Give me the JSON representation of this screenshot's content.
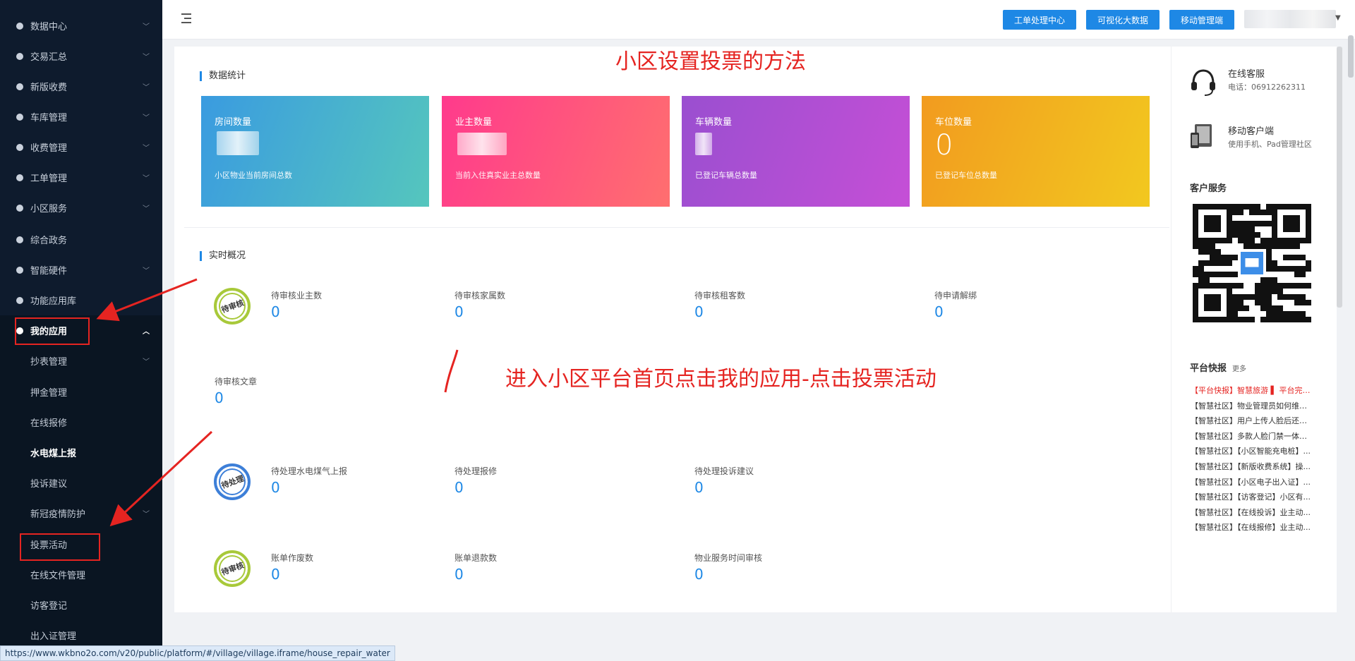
{
  "sidebar": {
    "items": [
      {
        "label": "数据中心",
        "icon": "database-icon"
      },
      {
        "label": "交易汇总",
        "icon": "money-bag-icon"
      },
      {
        "label": "新版收费",
        "icon": "payment-icon"
      },
      {
        "label": "车库管理",
        "icon": "car-icon"
      },
      {
        "label": "收费管理",
        "icon": "money-bag-icon"
      },
      {
        "label": "工单管理",
        "icon": "wrench-icon"
      },
      {
        "label": "小区服务",
        "icon": "service-icon"
      },
      {
        "label": "综合政务",
        "icon": "bank-icon"
      },
      {
        "label": "智能硬件",
        "icon": "hardware-icon"
      },
      {
        "label": "功能应用库",
        "icon": "cube-icon"
      },
      {
        "label": "我的应用",
        "icon": "user-icon"
      }
    ],
    "sub_items": [
      "抄表管理",
      "押金管理",
      "在线报修",
      "水电煤上报",
      "投诉建议",
      "新冠疫情防护",
      "投票活动",
      "在线文件管理",
      "访客登记",
      "出入证管理"
    ]
  },
  "topbar": {
    "buttons": [
      "工单处理中心",
      "可视化大数据",
      "移动管理端"
    ]
  },
  "annotations": {
    "title": "小区设置投票的方法",
    "instruction": "进入小区平台首页点击我的应用-点击投票活动"
  },
  "data_stats": {
    "title": "数据统计",
    "cards": [
      {
        "label": "房间数量",
        "value": "",
        "desc": "小区物业当前房间总数",
        "color1": "#3a9be0",
        "color2": "#55c6bd"
      },
      {
        "label": "业主数量",
        "value": "",
        "desc": "当前入住真实业主总数量",
        "color1": "#ff3a8c",
        "color2": "#ff6f6f"
      },
      {
        "label": "车辆数量",
        "value": "",
        "desc": "已登记车辆总数量",
        "color1": "#9a4fd0",
        "color2": "#c54fd6"
      },
      {
        "label": "车位数量",
        "value": "0",
        "desc": "已登记车位总数量",
        "color1": "#f29b1f",
        "color2": "#f2c81f"
      }
    ]
  },
  "realtime": {
    "title": "实时概况",
    "stamps": [
      "待审核",
      "待处理",
      "待审核"
    ],
    "group1": [
      {
        "label": "待审核业主数",
        "value": "0"
      },
      {
        "label": "待审核家属数",
        "value": "0"
      },
      {
        "label": "待审核租客数",
        "value": "0"
      },
      {
        "label": "待申请解绑",
        "value": "0"
      },
      {
        "label": "待审核文章",
        "value": "0"
      }
    ],
    "group2": [
      {
        "label": "待处理水电煤气上报",
        "value": "0"
      },
      {
        "label": "待处理报修",
        "value": "0"
      },
      {
        "label": "待处理投诉建议",
        "value": "0"
      }
    ],
    "group3": [
      {
        "label": "账单作废数",
        "value": "0"
      },
      {
        "label": "账单退款数",
        "value": "0"
      },
      {
        "label": "物业服务时间审核",
        "value": "0"
      }
    ]
  },
  "right_panel": {
    "online_service": {
      "title": "在线客服",
      "phone": "电话：06912262311"
    },
    "mobile_client": {
      "title": "移动客户端",
      "desc": "使用手机、Pad管理社区"
    },
    "customer_service": "客户服务",
    "news_title": "平台快报",
    "more": "更多",
    "news": [
      "【平台快报】智慧旅游 ▌ 平台完成...",
      "【智慧社区】物业管理员如何维护...",
      "【智慧社区】用户上传人脸后还是...",
      "【智慧社区】多款人脸门禁一体机...",
      "【智慧社区】【小区智能充电桩】...",
      "【智慧社区】【新版收费系统】操...",
      "【智慧社区】【小区电子出入证】...",
      "【智慧社区】【访客登记】小区有...",
      "【智慧社区】【在线投诉】业主动...",
      "【智慧社区】【在线报修】业主动..."
    ]
  },
  "status_url": "https://www.wkbno2o.com/v20/public/platform/#/village/village.iframe/house_repair_water",
  "colors": {
    "sidebar": "#0e1b2d",
    "accent": "#1e88e5",
    "annotation": "#e52421"
  }
}
